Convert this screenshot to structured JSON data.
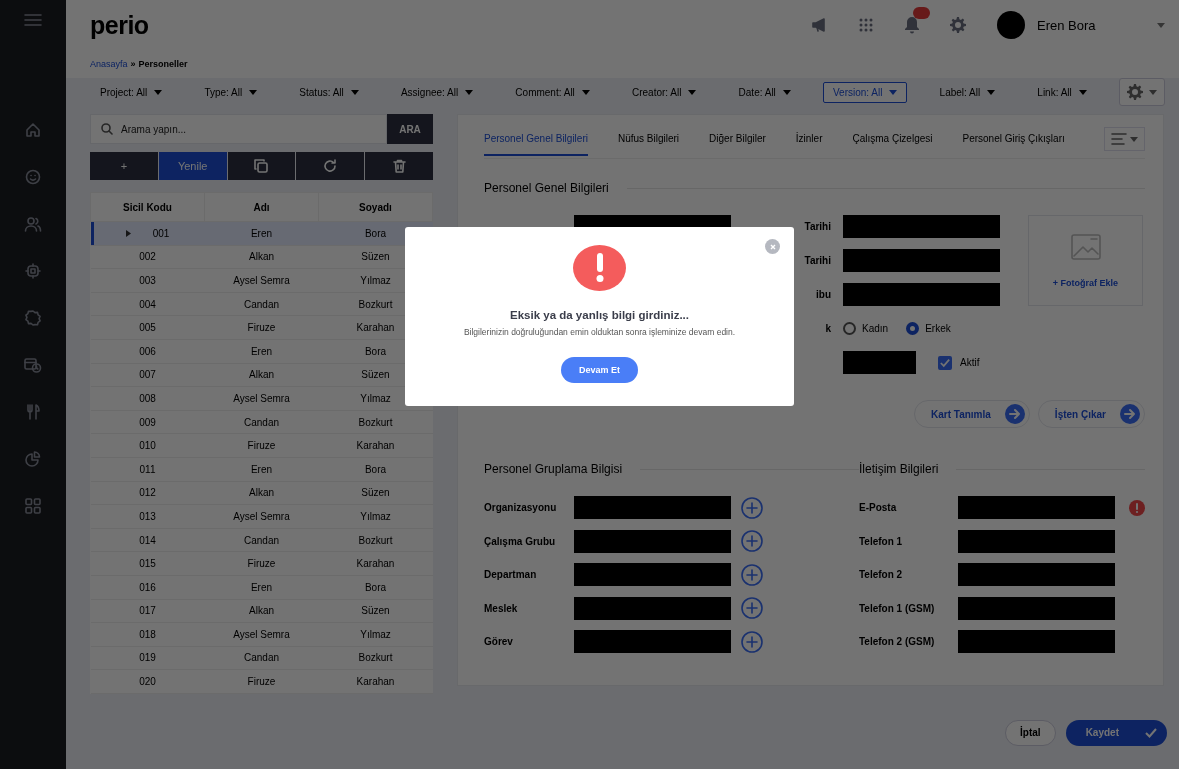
{
  "header": {
    "logo": "perio",
    "user_name": "Eren Bora"
  },
  "breadcrumb": {
    "link": "Anasayfa",
    "separator": "»",
    "current": "Personeller"
  },
  "filters": [
    {
      "label": "Project: All",
      "selected": false
    },
    {
      "label": "Type: All",
      "selected": false
    },
    {
      "label": "Status: All",
      "selected": false
    },
    {
      "label": "Assignee: All",
      "selected": false
    },
    {
      "label": "Comment: All",
      "selected": false
    },
    {
      "label": "Creator: All",
      "selected": false
    },
    {
      "label": "Date: All",
      "selected": false
    },
    {
      "label": "Version: All",
      "selected": true
    },
    {
      "label": "Label: All",
      "selected": false
    },
    {
      "label": "Link: All",
      "selected": false
    }
  ],
  "search": {
    "placeholder": "Arama yapın...",
    "button": "ARA"
  },
  "toolbar": [
    {
      "kind": "text",
      "label": "+",
      "selected": false
    },
    {
      "kind": "text",
      "label": "Yenile",
      "selected": true
    },
    {
      "kind": "copy",
      "selected": false
    },
    {
      "kind": "refresh",
      "selected": false
    },
    {
      "kind": "delete",
      "selected": false
    }
  ],
  "table": {
    "columns": [
      "Sicil Kodu",
      "Adı",
      "Soyadı"
    ],
    "rows": [
      {
        "cells": [
          "001",
          "Eren",
          "Bora"
        ],
        "selected": true
      },
      {
        "cells": [
          "002",
          "Alkan",
          "Süzen"
        ],
        "selected": false
      },
      {
        "cells": [
          "003",
          "Aysel Semra",
          "Yılmaz"
        ],
        "selected": false
      },
      {
        "cells": [
          "004",
          "Candan",
          "Bozkurt"
        ],
        "selected": false
      },
      {
        "cells": [
          "005",
          "Firuze",
          "Karahan"
        ],
        "selected": false
      },
      {
        "cells": [
          "006",
          "Eren",
          "Bora"
        ],
        "selected": false
      },
      {
        "cells": [
          "007",
          "Alkan",
          "Süzen"
        ],
        "selected": false
      },
      {
        "cells": [
          "008",
          "Aysel Semra",
          "Yılmaz"
        ],
        "selected": false
      },
      {
        "cells": [
          "009",
          "Candan",
          "Bozkurt"
        ],
        "selected": false
      },
      {
        "cells": [
          "010",
          "Firuze",
          "Karahan"
        ],
        "selected": false
      },
      {
        "cells": [
          "011",
          "Eren",
          "Bora"
        ],
        "selected": false
      },
      {
        "cells": [
          "012",
          "Alkan",
          "Süzen"
        ],
        "selected": false
      },
      {
        "cells": [
          "013",
          "Aysel Semra",
          "Yılmaz"
        ],
        "selected": false
      },
      {
        "cells": [
          "014",
          "Candan",
          "Bozkurt"
        ],
        "selected": false
      },
      {
        "cells": [
          "015",
          "Firuze",
          "Karahan"
        ],
        "selected": false
      },
      {
        "cells": [
          "016",
          "Eren",
          "Bora"
        ],
        "selected": false
      },
      {
        "cells": [
          "017",
          "Alkan",
          "Süzen"
        ],
        "selected": false
      },
      {
        "cells": [
          "018",
          "Aysel Semra",
          "Yılmaz"
        ],
        "selected": false
      },
      {
        "cells": [
          "019",
          "Candan",
          "Bozkurt"
        ],
        "selected": false
      },
      {
        "cells": [
          "020",
          "Firuze",
          "Karahan"
        ],
        "selected": false
      }
    ]
  },
  "tabs": [
    {
      "label": "Personel Genel Bilgileri",
      "selected": true
    },
    {
      "label": "Nüfus Bilgileri",
      "selected": false
    },
    {
      "label": "Diğer Bilgiler",
      "selected": false
    },
    {
      "label": "İzinler",
      "selected": false
    },
    {
      "label": "Çalışma Çizelgesi",
      "selected": false
    },
    {
      "label": "Personel Giriş Çıkışları",
      "selected": false
    }
  ],
  "general": {
    "title": "Personel Genel Bilgileri",
    "rows": [
      {
        "kind": "select",
        "label": "Tarihi"
      },
      {
        "kind": "select",
        "label": "Tarihi"
      },
      {
        "kind": "select",
        "label": "ibu"
      },
      {
        "kind": "radio",
        "label": "k",
        "options": [
          {
            "label": "Kadın",
            "selected": false
          },
          {
            "label": "Erkek",
            "selected": true
          }
        ]
      },
      {
        "kind": "input_check",
        "check": {
          "label": "Aktif",
          "checked": true
        }
      }
    ],
    "photo_action": "+ Fotoğraf Ekle",
    "actions": [
      "Kart Tanımla",
      "İşten Çıkar"
    ]
  },
  "grouping": {
    "title": "Personel Gruplama Bilgisi",
    "rows": [
      "Organizasyonu",
      "Çalışma Grubu",
      "Departman",
      "Meslek",
      "Görev"
    ]
  },
  "contact": {
    "title": "İletişim Bilgileri",
    "rows": [
      {
        "label": "E-Posta",
        "error": true
      },
      {
        "label": "Telefon 1",
        "error": false
      },
      {
        "label": "Telefon 2",
        "error": false
      },
      {
        "label": "Telefon 1 (GSM)",
        "error": false
      },
      {
        "label": "Telefon 2 (GSM)",
        "error": false
      }
    ]
  },
  "footer": {
    "cancel": "İptal",
    "save": "Kaydet"
  },
  "modal": {
    "title": "Eksik ya da yanlış bilgi girdiniz...",
    "message": "Bilgilerinizin doğruluğundan emin olduktan sonra işleminize devam edin.",
    "button": "Devam Et"
  }
}
